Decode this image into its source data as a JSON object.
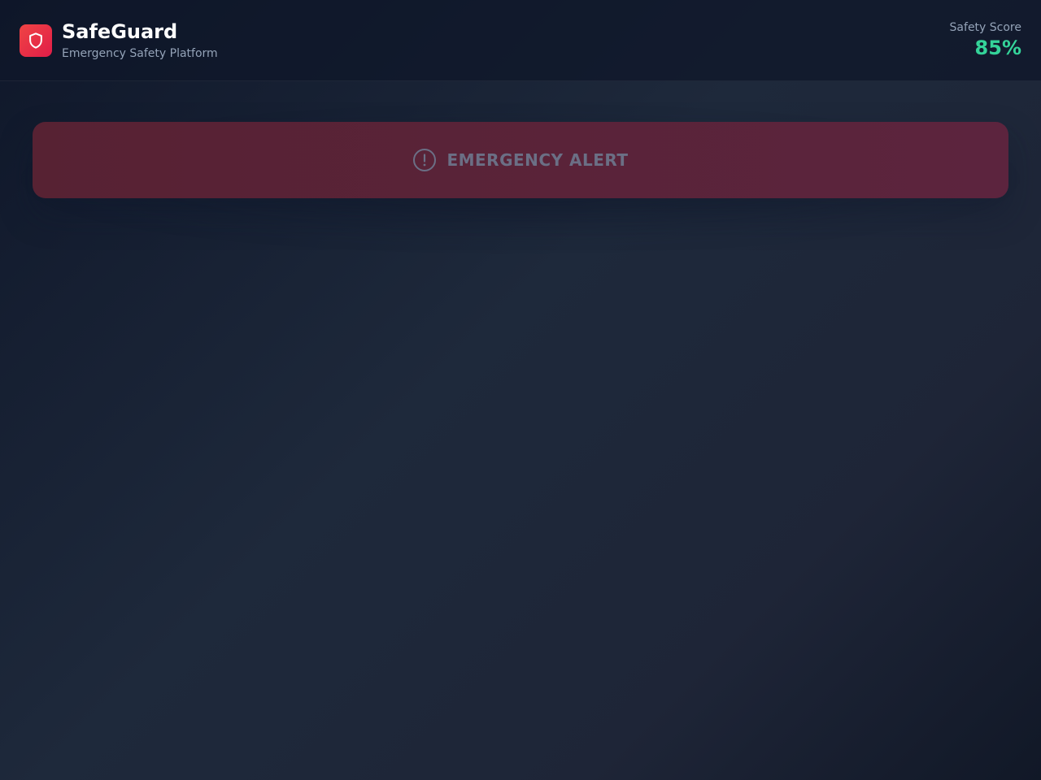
{
  "header": {
    "title": "SafeGuard",
    "subtitle": "Emergency Safety Platform",
    "logo_icon": "shield-icon"
  },
  "safety_score": {
    "label": "Safety Score",
    "value": "85%",
    "color": "#34d399"
  },
  "emergency": {
    "label": "EMERGENCY ALERT",
    "icon": "alert-circle-icon"
  },
  "colors": {
    "brand": "#e11d48",
    "alert_bg": "#5a2338",
    "background": "#1e293b"
  }
}
